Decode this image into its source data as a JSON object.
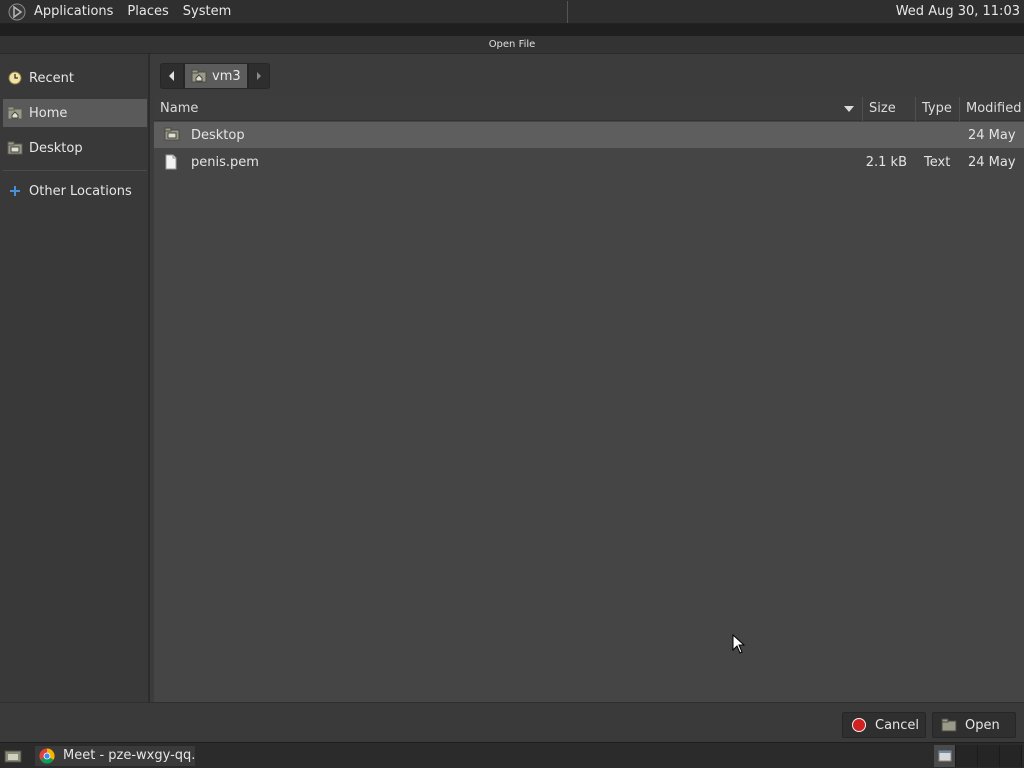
{
  "top_panel": {
    "menus": [
      "Applications",
      "Places",
      "System"
    ],
    "clock": "Wed Aug 30, 11:03",
    "logo_icon": "distro-logo-icon"
  },
  "dialog": {
    "title": "Open File"
  },
  "sidebar": {
    "items": [
      {
        "label": "Recent",
        "icon": "clock-icon"
      },
      {
        "label": "Home",
        "icon": "home-folder-icon",
        "selected": true
      },
      {
        "label": "Desktop",
        "icon": "desktop-folder-icon"
      },
      {
        "label": "Other Locations",
        "icon": "plus-icon"
      }
    ]
  },
  "pathbar": {
    "current": "vm3"
  },
  "filelist": {
    "columns": {
      "name": "Name",
      "size": "Size",
      "type": "Type",
      "modified": "Modified"
    },
    "rows": [
      {
        "name": "Desktop",
        "size": "",
        "type": "",
        "modified": "24 May",
        "icon": "folder-icon",
        "selected": true
      },
      {
        "name": "penis.pem",
        "size": "2.1 kB",
        "type": "Text",
        "modified": "24 May",
        "icon": "text-file-icon"
      }
    ]
  },
  "actions": {
    "cancel_label": "Cancel",
    "open_label": "Open"
  },
  "taskbar": {
    "window_title": "Meet - pze-wxgy-qq...",
    "workspaces": 4
  },
  "colors": {
    "selected_row": "#5e5e5e",
    "background": "#454545",
    "cancel_red": "#d21f1f",
    "accent_blue": "#4a90d9"
  }
}
